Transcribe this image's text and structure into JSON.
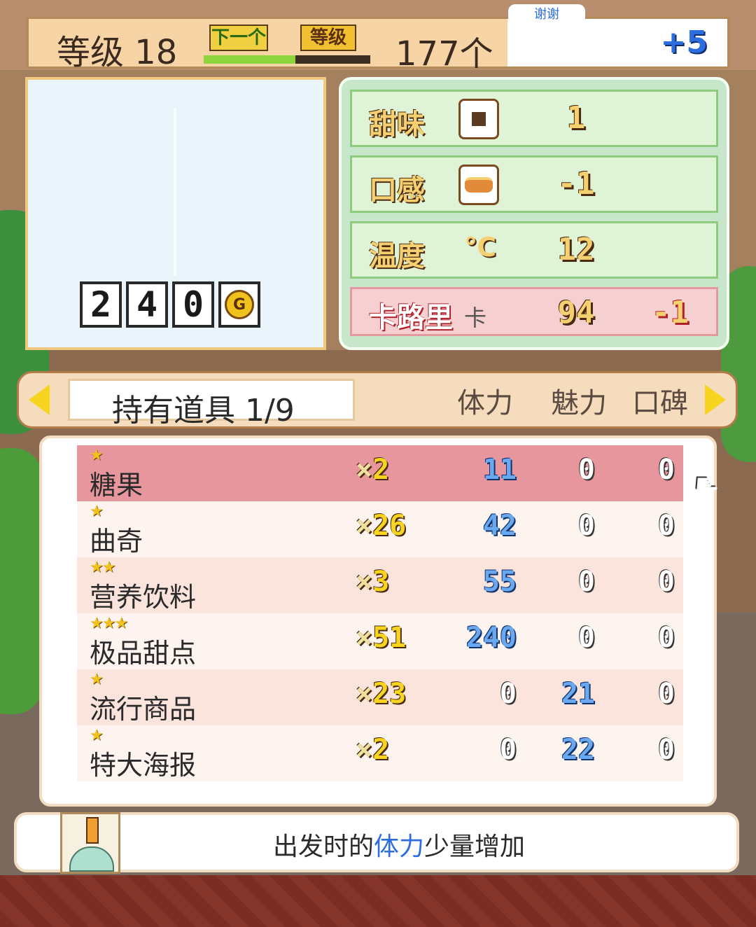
{
  "header": {
    "level_label": "等级 18",
    "next_badge": "下一个",
    "level_badge": "等级",
    "xp_progress": 0.55,
    "count": "177个",
    "bonus": "+5",
    "thanks_tab": "谢谢"
  },
  "preview": {
    "price_digits": [
      "2",
      "4",
      "0"
    ],
    "currency_icon": "G"
  },
  "stats": {
    "sweet": {
      "label": "甜味",
      "icon": "square-icon",
      "value": "1"
    },
    "texture": {
      "label": "口感",
      "icon": "bread-icon",
      "value": "-1"
    },
    "temperature": {
      "label": "温度",
      "unit": "℃",
      "value": "12"
    },
    "calories": {
      "label": "卡路里",
      "unit": "卡",
      "value": "94",
      "delta": "-1"
    }
  },
  "items_bar": {
    "tab_label": "持有道具 1/9",
    "col_stamina": "体力",
    "col_charm": "魅力",
    "col_reputation": "口碑"
  },
  "items": [
    {
      "stars": "★",
      "name": "糖果",
      "x": "×",
      "qty": "2",
      "stamina": "11",
      "charm": "0",
      "reputation": "0"
    },
    {
      "stars": "★",
      "name": "曲奇",
      "x": "×",
      "qty": "26",
      "stamina": "42",
      "charm": "0",
      "reputation": "0"
    },
    {
      "stars": "★★",
      "name": "营养饮料",
      "x": "×",
      "qty": "3",
      "stamina": "55",
      "charm": "0",
      "reputation": "0"
    },
    {
      "stars": "★★★",
      "name": "极品甜点",
      "x": "×",
      "qty": "51",
      "stamina": "240",
      "charm": "0",
      "reputation": "0"
    },
    {
      "stars": "★",
      "name": "流行商品",
      "x": "×",
      "qty": "23",
      "stamina": "0",
      "charm": "21",
      "reputation": "0"
    },
    {
      "stars": "★",
      "name": "特大海报",
      "x": "×",
      "qty": "2",
      "stamina": "0",
      "charm": "22",
      "reputation": "0"
    }
  ],
  "description": {
    "prefix": "出发时的",
    "highlight": "体力",
    "suffix": "少量增加"
  },
  "colors": {
    "selected_row": "#e8969e",
    "positive_value": "#6aa8f0",
    "highlight_text": "#2c6de0"
  }
}
